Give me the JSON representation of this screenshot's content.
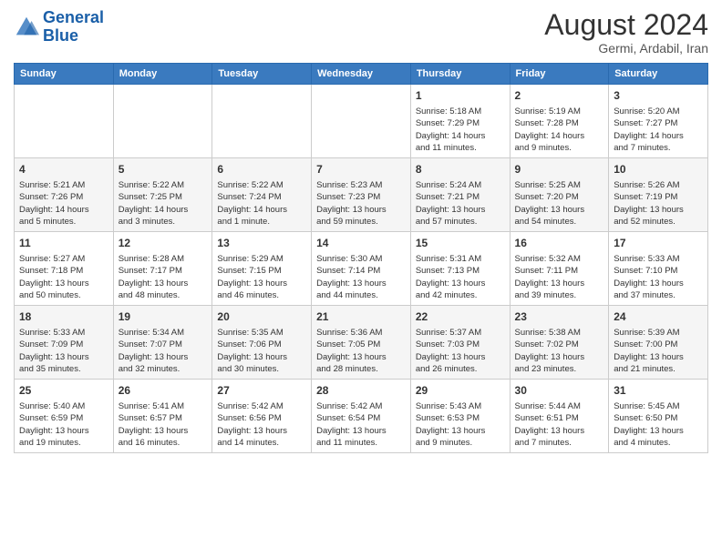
{
  "header": {
    "logo_line1": "General",
    "logo_line2": "Blue",
    "month": "August 2024",
    "location": "Germi, Ardabil, Iran"
  },
  "weekdays": [
    "Sunday",
    "Monday",
    "Tuesday",
    "Wednesday",
    "Thursday",
    "Friday",
    "Saturday"
  ],
  "weeks": [
    [
      {
        "day": "",
        "info": ""
      },
      {
        "day": "",
        "info": ""
      },
      {
        "day": "",
        "info": ""
      },
      {
        "day": "",
        "info": ""
      },
      {
        "day": "1",
        "info": "Sunrise: 5:18 AM\nSunset: 7:29 PM\nDaylight: 14 hours\nand 11 minutes."
      },
      {
        "day": "2",
        "info": "Sunrise: 5:19 AM\nSunset: 7:28 PM\nDaylight: 14 hours\nand 9 minutes."
      },
      {
        "day": "3",
        "info": "Sunrise: 5:20 AM\nSunset: 7:27 PM\nDaylight: 14 hours\nand 7 minutes."
      }
    ],
    [
      {
        "day": "4",
        "info": "Sunrise: 5:21 AM\nSunset: 7:26 PM\nDaylight: 14 hours\nand 5 minutes."
      },
      {
        "day": "5",
        "info": "Sunrise: 5:22 AM\nSunset: 7:25 PM\nDaylight: 14 hours\nand 3 minutes."
      },
      {
        "day": "6",
        "info": "Sunrise: 5:22 AM\nSunset: 7:24 PM\nDaylight: 14 hours\nand 1 minute."
      },
      {
        "day": "7",
        "info": "Sunrise: 5:23 AM\nSunset: 7:23 PM\nDaylight: 13 hours\nand 59 minutes."
      },
      {
        "day": "8",
        "info": "Sunrise: 5:24 AM\nSunset: 7:21 PM\nDaylight: 13 hours\nand 57 minutes."
      },
      {
        "day": "9",
        "info": "Sunrise: 5:25 AM\nSunset: 7:20 PM\nDaylight: 13 hours\nand 54 minutes."
      },
      {
        "day": "10",
        "info": "Sunrise: 5:26 AM\nSunset: 7:19 PM\nDaylight: 13 hours\nand 52 minutes."
      }
    ],
    [
      {
        "day": "11",
        "info": "Sunrise: 5:27 AM\nSunset: 7:18 PM\nDaylight: 13 hours\nand 50 minutes."
      },
      {
        "day": "12",
        "info": "Sunrise: 5:28 AM\nSunset: 7:17 PM\nDaylight: 13 hours\nand 48 minutes."
      },
      {
        "day": "13",
        "info": "Sunrise: 5:29 AM\nSunset: 7:15 PM\nDaylight: 13 hours\nand 46 minutes."
      },
      {
        "day": "14",
        "info": "Sunrise: 5:30 AM\nSunset: 7:14 PM\nDaylight: 13 hours\nand 44 minutes."
      },
      {
        "day": "15",
        "info": "Sunrise: 5:31 AM\nSunset: 7:13 PM\nDaylight: 13 hours\nand 42 minutes."
      },
      {
        "day": "16",
        "info": "Sunrise: 5:32 AM\nSunset: 7:11 PM\nDaylight: 13 hours\nand 39 minutes."
      },
      {
        "day": "17",
        "info": "Sunrise: 5:33 AM\nSunset: 7:10 PM\nDaylight: 13 hours\nand 37 minutes."
      }
    ],
    [
      {
        "day": "18",
        "info": "Sunrise: 5:33 AM\nSunset: 7:09 PM\nDaylight: 13 hours\nand 35 minutes."
      },
      {
        "day": "19",
        "info": "Sunrise: 5:34 AM\nSunset: 7:07 PM\nDaylight: 13 hours\nand 32 minutes."
      },
      {
        "day": "20",
        "info": "Sunrise: 5:35 AM\nSunset: 7:06 PM\nDaylight: 13 hours\nand 30 minutes."
      },
      {
        "day": "21",
        "info": "Sunrise: 5:36 AM\nSunset: 7:05 PM\nDaylight: 13 hours\nand 28 minutes."
      },
      {
        "day": "22",
        "info": "Sunrise: 5:37 AM\nSunset: 7:03 PM\nDaylight: 13 hours\nand 26 minutes."
      },
      {
        "day": "23",
        "info": "Sunrise: 5:38 AM\nSunset: 7:02 PM\nDaylight: 13 hours\nand 23 minutes."
      },
      {
        "day": "24",
        "info": "Sunrise: 5:39 AM\nSunset: 7:00 PM\nDaylight: 13 hours\nand 21 minutes."
      }
    ],
    [
      {
        "day": "25",
        "info": "Sunrise: 5:40 AM\nSunset: 6:59 PM\nDaylight: 13 hours\nand 19 minutes."
      },
      {
        "day": "26",
        "info": "Sunrise: 5:41 AM\nSunset: 6:57 PM\nDaylight: 13 hours\nand 16 minutes."
      },
      {
        "day": "27",
        "info": "Sunrise: 5:42 AM\nSunset: 6:56 PM\nDaylight: 13 hours\nand 14 minutes."
      },
      {
        "day": "28",
        "info": "Sunrise: 5:42 AM\nSunset: 6:54 PM\nDaylight: 13 hours\nand 11 minutes."
      },
      {
        "day": "29",
        "info": "Sunrise: 5:43 AM\nSunset: 6:53 PM\nDaylight: 13 hours\nand 9 minutes."
      },
      {
        "day": "30",
        "info": "Sunrise: 5:44 AM\nSunset: 6:51 PM\nDaylight: 13 hours\nand 7 minutes."
      },
      {
        "day": "31",
        "info": "Sunrise: 5:45 AM\nSunset: 6:50 PM\nDaylight: 13 hours\nand 4 minutes."
      }
    ]
  ]
}
